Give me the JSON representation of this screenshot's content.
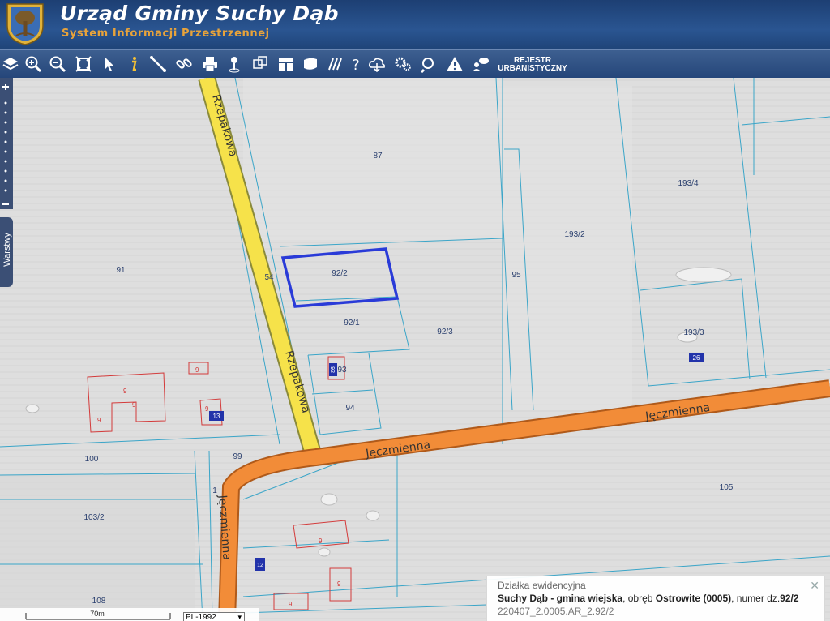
{
  "header": {
    "title": "Urząd Gminy Suchy Dąb",
    "subtitle": "System Informacji Przestrzennej"
  },
  "toolbar": {
    "rejestr_line1": "REJESTR",
    "rejestr_line2": "URBANISTYCZNY"
  },
  "sidebar": {
    "layers_label": "Warstwy",
    "zoom_in": "+",
    "zoom_out": "–"
  },
  "map": {
    "streets": {
      "rzepakowa": "Rzepakowa",
      "jeczmienna": "Jęczmienna"
    },
    "parcels": {
      "p87": "87",
      "p91": "91",
      "p92_2": "92/2",
      "p92_1": "92/1",
      "p92_3": "92/3",
      "p93": "93",
      "p94": "94",
      "p95": "95",
      "p99": "99",
      "p100": "100",
      "p103_2": "103/2",
      "p105": "105",
      "p108": "108",
      "p193_2": "193/2",
      "p193_3": "193/3",
      "p193_4": "193/4",
      "p54": "54",
      "p1": "1"
    },
    "building_labels": {
      "b9": "9",
      "n13": "13",
      "n26": "26",
      "n92": "92",
      "n12": "12"
    }
  },
  "scale": {
    "label": "70m",
    "crs": "PL-1992"
  },
  "info": {
    "heading": "Działka ewidencyjna",
    "line_bold1": "Suchy Dąb - gmina wiejska",
    "line_mid": ", obręb ",
    "line_bold2": "Ostrowite (0005)",
    "line_mid2": ", numer dz.",
    "line_bold3": "92/2",
    "id": "220407_2.0005.AR_2.92/2"
  }
}
